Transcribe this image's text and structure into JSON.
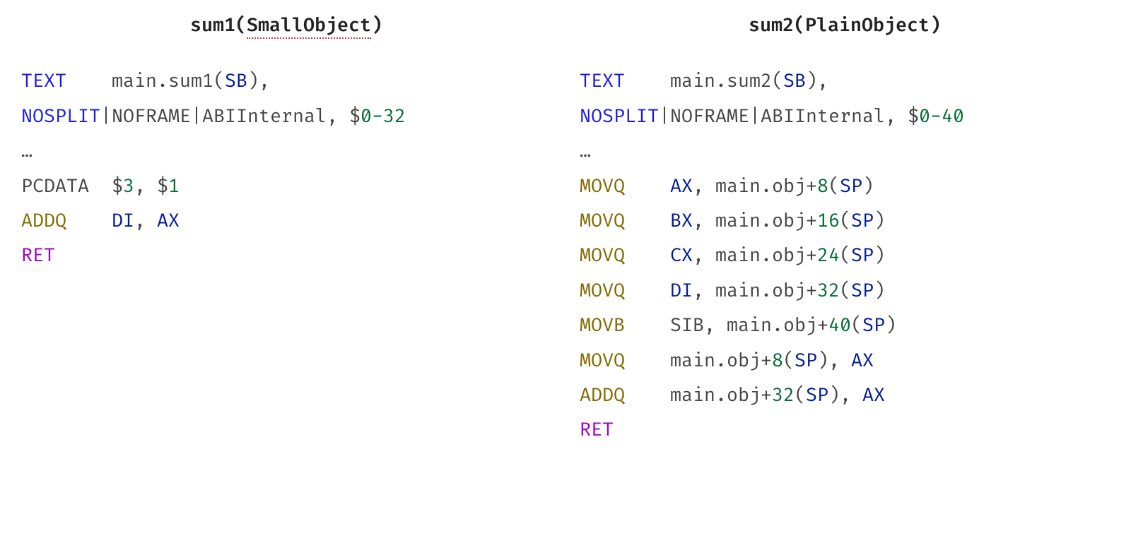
{
  "left": {
    "title_fn": "sum1(",
    "title_arg": "SmallObject",
    "title_close": ")",
    "l1": {
      "dir": "TEXT",
      "sym": "main.sum1",
      "reg": "SB"
    },
    "l2": {
      "dir": "NOSPLIT",
      "a": "NOFRAME",
      "b": "ABIInternal",
      "n1": "0",
      "n2": "32"
    },
    "dots": "…",
    "l3": {
      "sym": "PCDATA",
      "n1": "3",
      "n2": "1"
    },
    "l4": {
      "ins": "ADDQ",
      "r1": "DI",
      "r2": "AX"
    },
    "l5": {
      "ret": "RET"
    }
  },
  "right": {
    "title": "sum2(PlainObject)",
    "l1": {
      "dir": "TEXT",
      "sym": "main.sum2",
      "reg": "SB"
    },
    "l2": {
      "dir": "NOSPLIT",
      "a": "NOFRAME",
      "b": "ABIInternal",
      "n1": "0",
      "n2": "40"
    },
    "dots": "…",
    "m1": {
      "ins": "MOVQ",
      "reg": "AX",
      "sym": "main.obj+",
      "off": "8",
      "sp": "SP"
    },
    "m2": {
      "ins": "MOVQ",
      "reg": "BX",
      "sym": "main.obj+",
      "off": "16",
      "sp": "SP"
    },
    "m3": {
      "ins": "MOVQ",
      "reg": "CX",
      "sym": "main.obj+",
      "off": "24",
      "sp": "SP"
    },
    "m4": {
      "ins": "MOVQ",
      "reg": "DI",
      "sym": "main.obj+",
      "off": "32",
      "sp": "SP"
    },
    "m5": {
      "ins": "MOVB",
      "reg": "SIB",
      "sym": "main.obj+",
      "off": "40",
      "sp": "SP"
    },
    "m6": {
      "ins": "MOVQ",
      "sym": "main.obj+",
      "off": "8",
      "sp": "SP",
      "reg": "AX"
    },
    "m7": {
      "ins": "ADDQ",
      "sym": "main.obj+",
      "off": "32",
      "sp": "SP",
      "reg": "AX"
    },
    "ret": {
      "ret": "RET"
    }
  }
}
